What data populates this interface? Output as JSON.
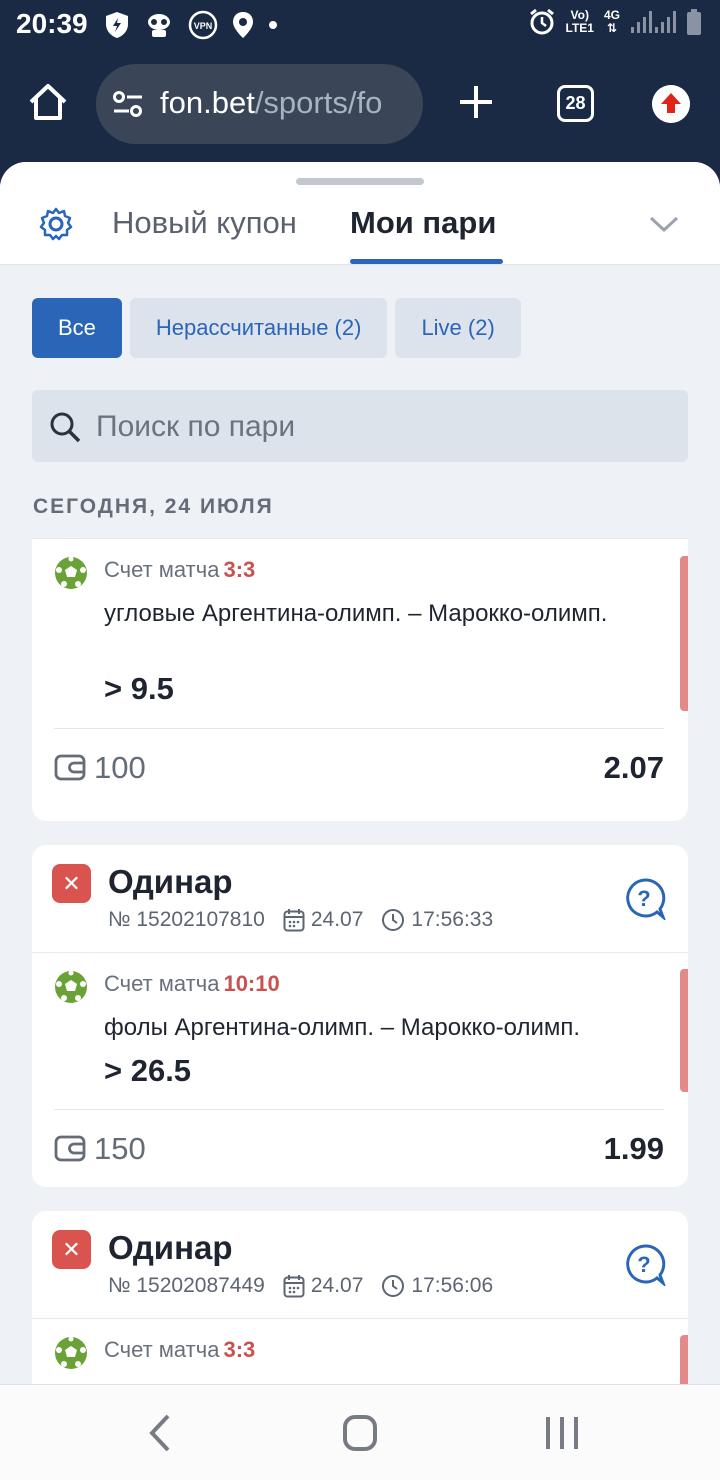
{
  "status_bar": {
    "time": "20:39",
    "net_top": "Vo)",
    "net_bottom": "LTE1",
    "net_type": "4G"
  },
  "browser": {
    "url_host": "fon.bet",
    "url_path": "/sports/fo",
    "tabs_count": "28"
  },
  "coupon": {
    "tab_new": "Новый купон",
    "tab_mine": "Мои пари"
  },
  "filters": [
    {
      "label": "Все",
      "active": true
    },
    {
      "label": "Нерассчитанные (2)",
      "active": false
    },
    {
      "label": "Live (2)",
      "active": false
    }
  ],
  "search": {
    "placeholder": "Поиск по пари"
  },
  "date_header": "СЕГОДНЯ, 24 ИЮЛЯ",
  "bets": [
    {
      "score_label": "Счет матча",
      "score": "3:3",
      "market": "угловые Аргентина-олимп. – Марокко-олимп.",
      "outcome": "> 9.5",
      "stake": "100",
      "coef": "2.07"
    },
    {
      "type": "Одинар",
      "number": "№ 15202107810",
      "date": "24.07",
      "time": "17:56:33",
      "score_label": "Счет матча",
      "score": "10:10",
      "market": "фолы Аргентина-олимп. – Марокко-олимп.",
      "outcome": "> 26.5",
      "stake": "150",
      "coef": "1.99"
    },
    {
      "type": "Одинар",
      "number": "№ 15202087449",
      "date": "24.07",
      "time": "17:56:06",
      "score_label": "Счет матча",
      "score": "3:3"
    }
  ],
  "icons": [
    "shield-icon",
    "robot-icon",
    "vpn-icon",
    "location-icon",
    "alarm-icon",
    "signal-icon",
    "battery-icon",
    "home-icon",
    "tune-icon",
    "plus-icon",
    "tabs-icon",
    "update-icon",
    "gear-icon",
    "chevron-down-icon",
    "search-icon",
    "soccer-ball-icon",
    "wallet-icon",
    "calendar-icon",
    "clock-icon",
    "help-icon",
    "back-icon",
    "home-nav-icon",
    "recents-icon"
  ],
  "colors": {
    "primary": "#2a65b8",
    "header_bg": "#1b2a44",
    "lost_red": "#d9534f",
    "score_red": "#c8524f"
  }
}
